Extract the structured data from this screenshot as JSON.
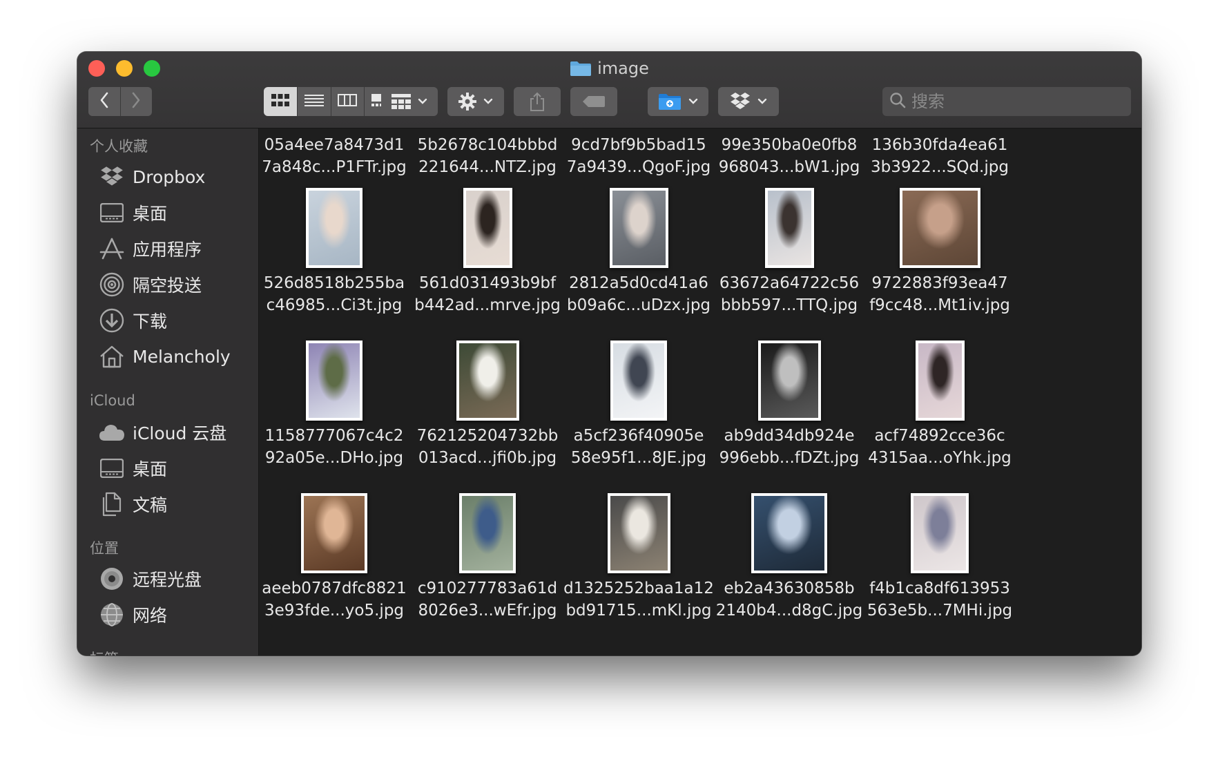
{
  "window": {
    "title": "image"
  },
  "toolbar": {
    "back_icon": "chevron-left-icon",
    "forward_icon": "chevron-right-icon",
    "view_modes": [
      "icon-view",
      "list-view",
      "column-view",
      "gallery-view"
    ],
    "active_view": "icon-view",
    "group_icon": "group-grid-icon",
    "action_icon": "gear-icon",
    "share_icon": "share-icon",
    "tag_icon": "tag-icon",
    "new_folder_icon": "new-folder-icon",
    "dropbox_icon": "dropbox-icon",
    "search_placeholder": "搜索"
  },
  "sidebar": {
    "favorites_heading": "个人收藏",
    "favorites": [
      {
        "label": "Dropbox",
        "icon": "dropbox-icon"
      },
      {
        "label": "桌面",
        "icon": "desktop-icon"
      },
      {
        "label": "应用程序",
        "icon": "applications-icon"
      },
      {
        "label": "隔空投送",
        "icon": "airdrop-icon"
      },
      {
        "label": "下载",
        "icon": "download-icon"
      },
      {
        "label": "Melancholy",
        "icon": "home-icon"
      }
    ],
    "icloud_heading": "iCloud",
    "icloud": [
      {
        "label": "iCloud 云盘",
        "icon": "icloud-icon"
      },
      {
        "label": "桌面",
        "icon": "desktop-icon"
      },
      {
        "label": "文稿",
        "icon": "documents-icon"
      }
    ],
    "locations_heading": "位置",
    "locations": [
      {
        "label": "远程光盘",
        "icon": "disc-icon"
      },
      {
        "label": "网络",
        "icon": "network-icon"
      }
    ],
    "tags_heading": "标签"
  },
  "files": [
    {
      "line1": "05a4ee7a8473d1",
      "line2": "7a848c...P1FTr.jpg"
    },
    {
      "line1": "5b2678c104bbbd",
      "line2": "221644...NTZ.jpg"
    },
    {
      "line1": "9cd7bf9b5bad15",
      "line2": "7a9439...QgoF.jpg"
    },
    {
      "line1": "99e350ba0e0fb8",
      "line2": "968043...bW1.jpg"
    },
    {
      "line1": "136b30fda4ea61",
      "line2": "3b3922...SQd.jpg"
    },
    {
      "line1": "526d8518b255ba",
      "line2": "c46985...Ci3t.jpg"
    },
    {
      "line1": "561d031493b9bf",
      "line2": "b442ad...mrve.jpg"
    },
    {
      "line1": "2812a5d0cd41a6",
      "line2": "b09a6c...uDzx.jpg"
    },
    {
      "line1": "63672a64722c56",
      "line2": "bbb597...TTQ.jpg"
    },
    {
      "line1": "9722883f93ea47",
      "line2": "f9cc48...Mt1iv.jpg"
    },
    {
      "line1": "1158777067c4c2",
      "line2": "92a05e...DHo.jpg"
    },
    {
      "line1": "762125204732bb",
      "line2": "013acd...jfi0b.jpg"
    },
    {
      "line1": "a5cf236f40905e",
      "line2": "58e95f1...8JE.jpg"
    },
    {
      "line1": "ab9dd34db924e",
      "line2": "996ebb...fDZt.jpg"
    },
    {
      "line1": "acf74892cce36c",
      "line2": "4315aa...oYhk.jpg"
    },
    {
      "line1": "aeeb0787dfc8821",
      "line2": "3e93fde...yo5.jpg"
    },
    {
      "line1": "c910277783a61d",
      "line2": "8026e3...wEfr.jpg"
    },
    {
      "line1": "d1325252baa1a12",
      "line2": "bd91715...mKl.jpg"
    },
    {
      "line1": "eb2a43630858b",
      "line2": "2140b4...d8gC.jpg"
    },
    {
      "line1": "f4b1ca8df613953",
      "line2": "563e5b...7MHi.jpg"
    }
  ],
  "thumbnails": [
    {
      "fill": [
        "#c9d3dd",
        "#e8d8cc",
        "#a7b6c4"
      ]
    },
    {
      "fill": [
        "#d9d1cc",
        "#2c2420",
        "#e7dcd4"
      ]
    },
    {
      "fill": [
        "#8a8f96",
        "#ddd3cc",
        "#5a5e64"
      ]
    },
    {
      "fill": [
        "#b8c0cb",
        "#3b3330",
        "#e9e4e2"
      ]
    },
    {
      "fill": [
        "#8a6a55",
        "#c6a08a",
        "#5d4636"
      ]
    },
    {
      "fill": [
        "#8e84b4",
        "#5e6c47",
        "#dfe3ec"
      ]
    },
    {
      "fill": [
        "#3d4a36",
        "#f0efe9",
        "#7a6a56"
      ]
    },
    {
      "fill": [
        "#d7dde3",
        "#404652",
        "#f3f4f6"
      ]
    },
    {
      "fill": [
        "#1a1a1a",
        "#bfbfbf",
        "#5a5a5a"
      ]
    },
    {
      "fill": [
        "#c8b8c6",
        "#2e2525",
        "#e6d7d8"
      ]
    },
    {
      "fill": [
        "#9c7454",
        "#e0b696",
        "#5b3a26"
      ]
    },
    {
      "fill": [
        "#6b7f6a",
        "#3e5c8a",
        "#a3b19d"
      ]
    },
    {
      "fill": [
        "#4a4a4a",
        "#ebe7e0",
        "#8c8273"
      ]
    },
    {
      "fill": [
        "#35506e",
        "#c2d0e2",
        "#1e2a38"
      ]
    },
    {
      "fill": [
        "#cfc7cb",
        "#7d7f99",
        "#ece6e6"
      ]
    }
  ]
}
